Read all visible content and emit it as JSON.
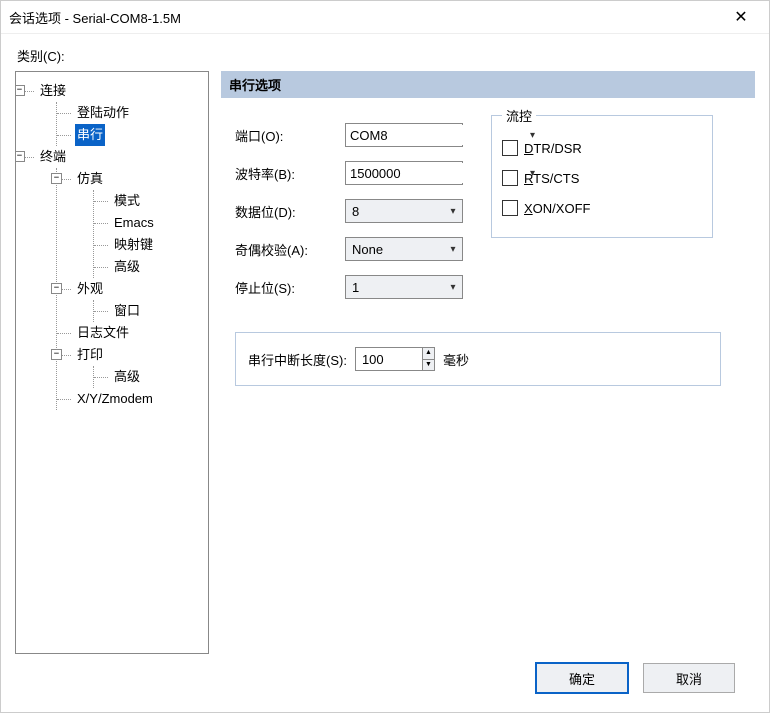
{
  "window": {
    "title": "会话选项 - Serial-COM8-1.5M"
  },
  "category_label": "类别(C):",
  "tree": {
    "connection": "连接",
    "login_action": "登陆动作",
    "serial": "串行",
    "terminal": "终端",
    "emulation": "仿真",
    "mode": "模式",
    "emacs": "Emacs",
    "map_keys": "映射键",
    "advanced_term": "高级",
    "appearance": "外观",
    "window_item": "窗口",
    "logfile": "日志文件",
    "printing": "打印",
    "advanced_print": "高级",
    "xyzmodem": "X/Y/Zmodem"
  },
  "section_title": "串行选项",
  "labels": {
    "port": "端口(O):",
    "baud": "波特率(B):",
    "databits": "数据位(D):",
    "parity": "奇偶校验(A):",
    "stopbits": "停止位(S):"
  },
  "values": {
    "port": "COM8",
    "baud": "1500000",
    "databits": "8",
    "parity": "None",
    "stopbits": "1"
  },
  "flow": {
    "legend": "流控",
    "dtrdsr": "DTR/DSR",
    "rtscts": "RTS/CTS",
    "xonxoff": "XON/XOFF"
  },
  "break": {
    "label": "串行中断长度(S):",
    "value": "100",
    "unit": "毫秒"
  },
  "buttons": {
    "ok": "确定",
    "cancel": "取消"
  }
}
